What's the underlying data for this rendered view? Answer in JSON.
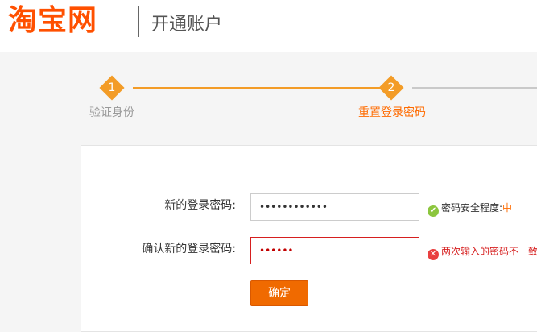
{
  "header": {
    "logo_text": "淘宝网",
    "page_title": "开通账户"
  },
  "steps": [
    {
      "number": "1",
      "label": "验证身份",
      "state": "done"
    },
    {
      "number": "2",
      "label": "重置登录密码",
      "state": "current"
    }
  ],
  "form": {
    "new_password": {
      "label": "新的登录密码:",
      "value": "••••••••••••",
      "hint_prefix": "密码安全程度:",
      "hint_level": "中"
    },
    "confirm_password": {
      "label": "确认新的登录密码:",
      "value": "••••••",
      "error": "两次输入的密码不一致"
    },
    "submit_label": "确定"
  },
  "colors": {
    "brand": "#ff5000",
    "accent": "#f39c27",
    "button": "#f06a00",
    "error": "#d61f1f",
    "ok": "#8cc63e"
  },
  "icons": {
    "ok": "check-circle-icon",
    "error": "x-circle-icon"
  }
}
